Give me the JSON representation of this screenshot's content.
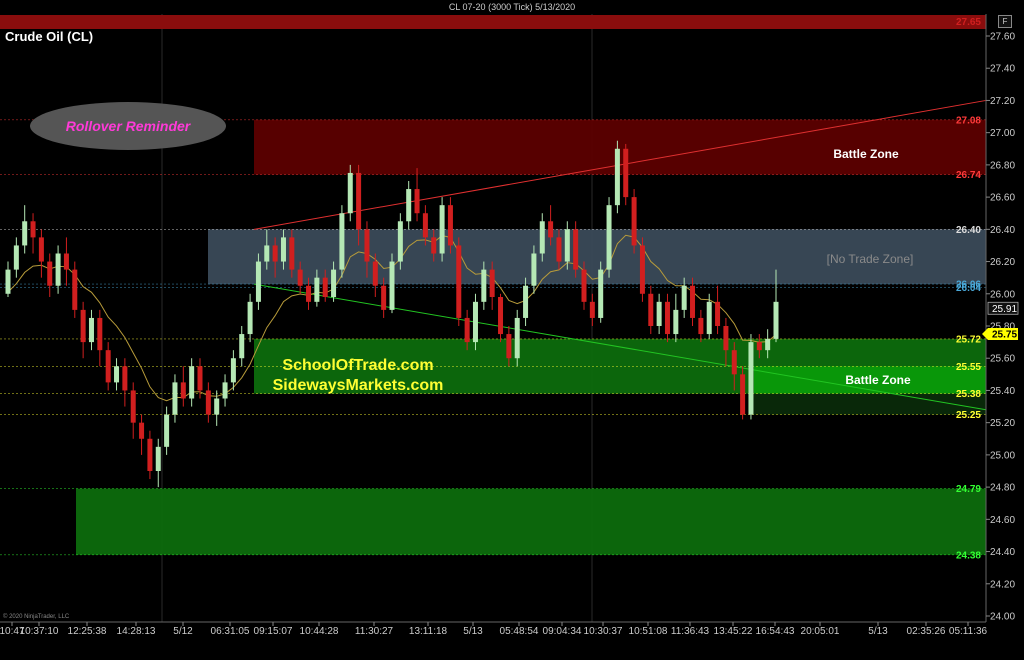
{
  "header": {
    "title": "CL 07-20 (3000 Tick)  5/13/2020"
  },
  "instrument": "Crude Oil (CL)",
  "copyright": "© 2020 NinjaTrader, LLC",
  "buttons": {
    "flag_label": "F",
    "scroll_icon": "arrow-right-icon"
  },
  "annotations": {
    "rollover": "Rollover Reminder",
    "site1": "SchoolOfTrade.com",
    "site2": "SidewaysMarkets.com",
    "battle_zone_top": "Battle Zone",
    "no_trade_zone": "[No Trade Zone]",
    "battle_zone_bottom": "Battle Zone"
  },
  "colors": {
    "background": "#000000",
    "candle_up": "#b5e8b5",
    "candle_down": "#d11f1f",
    "red_zone": "#5c0000",
    "gray_zone": "#3a4a58",
    "green_zone": "#0d6b0d",
    "green_zone_bright": "#0a9a0a",
    "ma_line": "#b79b3a",
    "current_price_bg": "#ffff00"
  },
  "chart_data": {
    "type": "candlestick",
    "title": "CL 07-20 (3000 Tick)  5/13/2020",
    "ylim": [
      24.0,
      27.65
    ],
    "y_ticks": [
      24.0,
      24.2,
      24.4,
      24.6,
      24.8,
      25.0,
      25.2,
      25.4,
      25.6,
      25.8,
      26.0,
      26.2,
      26.4,
      26.6,
      26.8,
      27.0,
      27.2,
      27.4,
      27.6
    ],
    "x_tick_labels": [
      "10:47",
      "10:37:10",
      "12:25:38",
      "14:28:13",
      "5/12",
      "06:31:05",
      "09:15:07",
      "10:44:28",
      "11:30:27",
      "13:11:18",
      "5/13",
      "05:48:54",
      "09:04:34",
      "10:30:37",
      "10:51:08",
      "11:36:43",
      "13:45:22",
      "16:54:43",
      "20:05:01",
      "5/13",
      "02:35:26",
      "05:11:36"
    ],
    "current_price": 25.75,
    "last_price_label": 25.91,
    "levels": [
      {
        "label": "27.65",
        "value": 27.65,
        "color": "#d11f1f"
      },
      {
        "label": "27.08",
        "value": 27.08,
        "color": "#ff3a3a"
      },
      {
        "label": "26.74",
        "value": 26.74,
        "color": "#ff3a3a"
      },
      {
        "label": "26.40",
        "value": 26.4,
        "color": "#dddddd"
      },
      {
        "label": "26.06",
        "value": 26.06,
        "color": "#4aa8d8"
      },
      {
        "label": "26.04",
        "value": 26.04,
        "color": "#4aa8d8"
      },
      {
        "label": "25.72",
        "value": 25.72,
        "color": "#ffff33"
      },
      {
        "label": "25.55",
        "value": 25.55,
        "color": "#ffff33"
      },
      {
        "label": "25.38",
        "value": 25.38,
        "color": "#ffff33"
      },
      {
        "label": "25.25",
        "value": 25.25,
        "color": "#ffff33"
      },
      {
        "label": "24.79",
        "value": 24.79,
        "color": "#33ff33"
      },
      {
        "label": "24.38",
        "value": 24.38,
        "color": "#33ff33"
      }
    ],
    "zones": [
      {
        "name": "Battle Zone",
        "kind": "red",
        "from": 26.74,
        "to": 27.08
      },
      {
        "name": "[No Trade Zone]",
        "kind": "gray",
        "from": 26.06,
        "to": 26.4
      },
      {
        "name": "SchoolOfTrade.com",
        "kind": "green",
        "from": 25.38,
        "to": 25.72
      },
      {
        "name": "Battle Zone",
        "kind": "greenBright",
        "from": 25.38,
        "to": 25.55
      },
      {
        "name": "",
        "kind": "greenLow",
        "from": 25.25,
        "to": 25.38
      },
      {
        "name": "",
        "kind": "green",
        "from": 24.38,
        "to": 24.79
      }
    ],
    "candles": [
      [
        26.0,
        26.15,
        26.2,
        25.98
      ],
      [
        26.15,
        26.3,
        26.35,
        26.1
      ],
      [
        26.3,
        26.45,
        26.55,
        26.25
      ],
      [
        26.45,
        26.35,
        26.5,
        26.25
      ],
      [
        26.35,
        26.2,
        26.4,
        26.1
      ],
      [
        26.2,
        26.05,
        26.25,
        25.98
      ],
      [
        26.05,
        26.25,
        26.3,
        26.0
      ],
      [
        26.25,
        26.15,
        26.35,
        26.05
      ],
      [
        26.15,
        25.9,
        26.2,
        25.85
      ],
      [
        25.9,
        25.7,
        25.95,
        25.6
      ],
      [
        25.7,
        25.85,
        25.9,
        25.65
      ],
      [
        25.85,
        25.65,
        25.9,
        25.55
      ],
      [
        25.65,
        25.45,
        25.7,
        25.4
      ],
      [
        25.45,
        25.55,
        25.6,
        25.4
      ],
      [
        25.55,
        25.4,
        25.6,
        25.3
      ],
      [
        25.4,
        25.2,
        25.45,
        25.1
      ],
      [
        25.2,
        25.1,
        25.25,
        25.0
      ],
      [
        25.1,
        24.9,
        25.15,
        24.85
      ],
      [
        24.9,
        25.05,
        25.1,
        24.8
      ],
      [
        25.05,
        25.25,
        25.3,
        25.0
      ],
      [
        25.25,
        25.45,
        25.5,
        25.2
      ],
      [
        25.45,
        25.35,
        25.55,
        25.3
      ],
      [
        25.35,
        25.55,
        25.6,
        25.3
      ],
      [
        25.55,
        25.4,
        25.6,
        25.35
      ],
      [
        25.4,
        25.25,
        25.45,
        25.2
      ],
      [
        25.25,
        25.35,
        25.4,
        25.18
      ],
      [
        25.35,
        25.45,
        25.5,
        25.3
      ],
      [
        25.45,
        25.6,
        25.65,
        25.4
      ],
      [
        25.6,
        25.75,
        25.8,
        25.55
      ],
      [
        25.75,
        25.95,
        26.0,
        25.7
      ],
      [
        25.95,
        26.2,
        26.25,
        25.9
      ],
      [
        26.2,
        26.3,
        26.4,
        26.15
      ],
      [
        26.3,
        26.2,
        26.35,
        26.1
      ],
      [
        26.2,
        26.35,
        26.4,
        26.15
      ],
      [
        26.35,
        26.15,
        26.4,
        26.1
      ],
      [
        26.15,
        26.05,
        26.2,
        26.0
      ],
      [
        26.05,
        25.95,
        26.1,
        25.9
      ],
      [
        25.95,
        26.1,
        26.15,
        25.92
      ],
      [
        26.1,
        25.98,
        26.15,
        25.95
      ],
      [
        25.98,
        26.15,
        26.2,
        25.95
      ],
      [
        26.15,
        26.5,
        26.55,
        26.1
      ],
      [
        26.5,
        26.75,
        26.8,
        26.45
      ],
      [
        26.75,
        26.4,
        26.8,
        26.3
      ],
      [
        26.4,
        26.2,
        26.45,
        26.1
      ],
      [
        26.2,
        26.05,
        26.25,
        25.98
      ],
      [
        26.05,
        25.9,
        26.1,
        25.85
      ],
      [
        25.9,
        26.2,
        26.25,
        25.88
      ],
      [
        26.2,
        26.45,
        26.5,
        26.15
      ],
      [
        26.45,
        26.65,
        26.7,
        26.4
      ],
      [
        26.65,
        26.5,
        26.78,
        26.45
      ],
      [
        26.5,
        26.35,
        26.55,
        26.3
      ],
      [
        26.35,
        26.25,
        26.4,
        26.2
      ],
      [
        26.25,
        26.55,
        26.6,
        26.2
      ],
      [
        26.55,
        26.3,
        26.6,
        26.25
      ],
      [
        26.3,
        25.85,
        26.35,
        25.8
      ],
      [
        25.85,
        25.7,
        25.9,
        25.65
      ],
      [
        25.7,
        25.95,
        26.0,
        25.65
      ],
      [
        25.95,
        26.15,
        26.2,
        25.9
      ],
      [
        26.15,
        25.98,
        26.2,
        25.9
      ],
      [
        25.98,
        25.75,
        26.0,
        25.7
      ],
      [
        25.75,
        25.6,
        25.8,
        25.55
      ],
      [
        25.6,
        25.85,
        25.9,
        25.55
      ],
      [
        25.85,
        26.05,
        26.1,
        25.8
      ],
      [
        26.05,
        26.25,
        26.3,
        26.0
      ],
      [
        26.25,
        26.45,
        26.5,
        26.2
      ],
      [
        26.45,
        26.35,
        26.55,
        26.3
      ],
      [
        26.35,
        26.2,
        26.4,
        26.15
      ],
      [
        26.2,
        26.4,
        26.45,
        26.15
      ],
      [
        26.4,
        26.15,
        26.45,
        26.1
      ],
      [
        26.15,
        25.95,
        26.2,
        25.9
      ],
      [
        25.95,
        25.85,
        26.0,
        25.8
      ],
      [
        25.85,
        26.15,
        26.2,
        25.82
      ],
      [
        26.15,
        26.55,
        26.6,
        26.1
      ],
      [
        26.55,
        26.9,
        26.95,
        26.5
      ],
      [
        26.9,
        26.6,
        26.93,
        26.55
      ],
      [
        26.6,
        26.3,
        26.65,
        26.25
      ],
      [
        26.3,
        26.0,
        26.35,
        25.95
      ],
      [
        26.0,
        25.8,
        26.05,
        25.75
      ],
      [
        25.8,
        25.95,
        26.0,
        25.75
      ],
      [
        25.95,
        25.75,
        26.0,
        25.7
      ],
      [
        25.75,
        25.9,
        26.0,
        25.7
      ],
      [
        25.9,
        26.05,
        26.1,
        25.85
      ],
      [
        26.05,
        25.85,
        26.1,
        25.8
      ],
      [
        25.85,
        25.75,
        25.9,
        25.7
      ],
      [
        25.75,
        25.95,
        26.0,
        25.72
      ],
      [
        25.95,
        25.8,
        26.05,
        25.75
      ],
      [
        25.8,
        25.65,
        25.85,
        25.55
      ],
      [
        25.65,
        25.5,
        25.7,
        25.4
      ],
      [
        25.5,
        25.25,
        25.55,
        25.22
      ],
      [
        25.25,
        25.7,
        25.75,
        25.22
      ],
      [
        25.7,
        25.65,
        25.75,
        25.6
      ],
      [
        25.65,
        25.72,
        25.78,
        25.6
      ],
      [
        25.72,
        25.95,
        26.15,
        25.7
      ]
    ]
  }
}
